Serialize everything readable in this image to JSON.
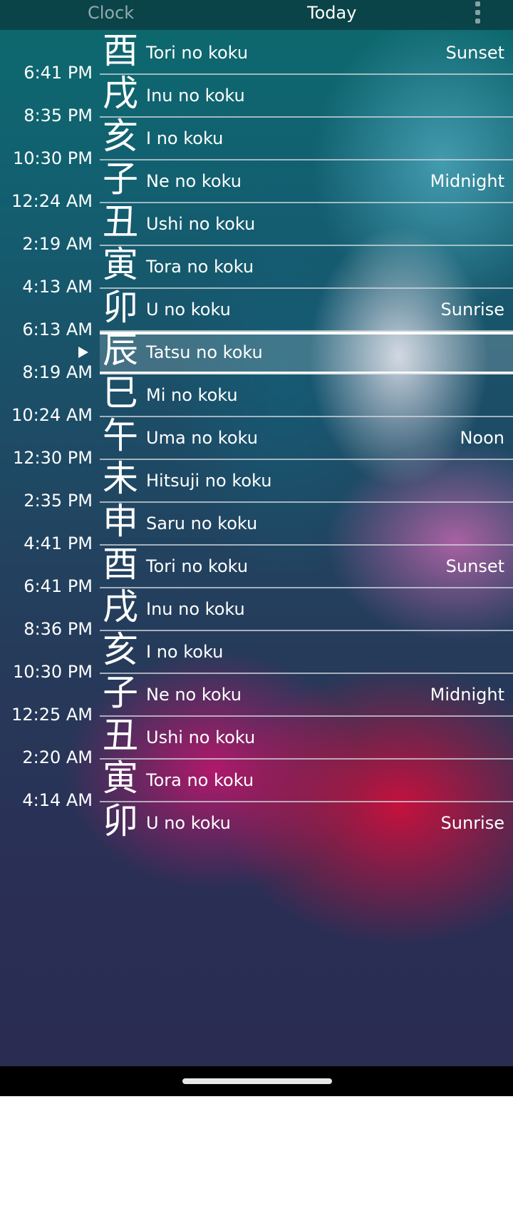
{
  "header": {
    "tab_clock": "Clock",
    "tab_today": "Today",
    "menu_icon": "more-vert-icon"
  },
  "current_index": 7,
  "rows": [
    {
      "kanji": "酉",
      "name": "Tori no koku",
      "event": "Sunset",
      "end_time": "6:41 PM"
    },
    {
      "kanji": "戌",
      "name": "Inu no koku",
      "event": "",
      "end_time": "8:35 PM"
    },
    {
      "kanji": "亥",
      "name": "I no koku",
      "event": "",
      "end_time": "10:30 PM"
    },
    {
      "kanji": "子",
      "name": "Ne no koku",
      "event": "Midnight",
      "end_time": "12:24 AM"
    },
    {
      "kanji": "丑",
      "name": "Ushi no koku",
      "event": "",
      "end_time": "2:19 AM"
    },
    {
      "kanji": "寅",
      "name": "Tora no koku",
      "event": "",
      "end_time": "4:13 AM"
    },
    {
      "kanji": "卯",
      "name": "U no koku",
      "event": "Sunrise",
      "end_time": "6:13 AM"
    },
    {
      "kanji": "辰",
      "name": "Tatsu no koku",
      "event": "",
      "end_time": "8:19 AM"
    },
    {
      "kanji": "巳",
      "name": "Mi no koku",
      "event": "",
      "end_time": "10:24 AM"
    },
    {
      "kanji": "午",
      "name": "Uma no koku",
      "event": "Noon",
      "end_time": "12:30 PM"
    },
    {
      "kanji": "未",
      "name": "Hitsuji no koku",
      "event": "",
      "end_time": "2:35 PM"
    },
    {
      "kanji": "申",
      "name": "Saru no koku",
      "event": "",
      "end_time": "4:41 PM"
    },
    {
      "kanji": "酉",
      "name": "Tori no koku",
      "event": "Sunset",
      "end_time": "6:41 PM"
    },
    {
      "kanji": "戌",
      "name": "Inu no koku",
      "event": "",
      "end_time": "8:36 PM"
    },
    {
      "kanji": "亥",
      "name": "I no koku",
      "event": "",
      "end_time": "10:30 PM"
    },
    {
      "kanji": "子",
      "name": "Ne no koku",
      "event": "Midnight",
      "end_time": "12:25 AM"
    },
    {
      "kanji": "丑",
      "name": "Ushi no koku",
      "event": "",
      "end_time": "2:20 AM"
    },
    {
      "kanji": "寅",
      "name": "Tora no koku",
      "event": "",
      "end_time": "4:14 AM"
    },
    {
      "kanji": "卯",
      "name": "U no koku",
      "event": "Sunrise",
      "end_time": ""
    }
  ]
}
